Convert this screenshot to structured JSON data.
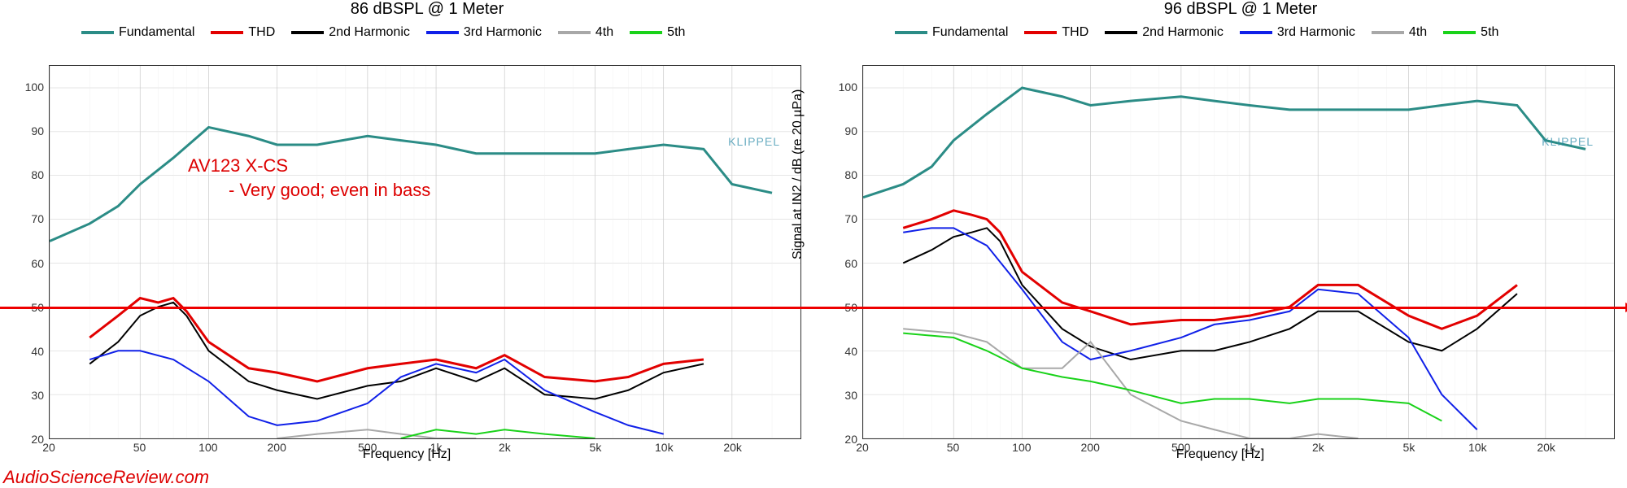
{
  "footer": "AudioScienceReview.com",
  "ref_line_db": 50,
  "legend": [
    {
      "name": "Fundamental",
      "color": "#2b8c86"
    },
    {
      "name": "THD",
      "color": "#e20000"
    },
    {
      "name": "2nd Harmonic",
      "color": "#000000"
    },
    {
      "name": "3rd Harmonic",
      "color": "#1020e8"
    },
    {
      "name": "4th",
      "color": "#a8a8a8"
    },
    {
      "name": "5th",
      "color": "#19d219"
    }
  ],
  "annotations": {
    "title": "AV123 X-CS",
    "subtitle": "- Very good; even in bass"
  },
  "klippel_logo": "KLIPPEL",
  "axes": {
    "xlabel": "Frequency [Hz]",
    "ylabel": "Signal at IN2 / dB (re 20 µPa)",
    "xlim": [
      20,
      40000
    ],
    "ylim": [
      20,
      105
    ],
    "xticks": [
      20,
      50,
      100,
      200,
      500,
      1000,
      2000,
      5000,
      10000,
      20000
    ],
    "xtick_labels": [
      "20",
      "50",
      "100",
      "200",
      "500",
      "1k",
      "2k",
      "5k",
      "10k",
      "20k"
    ],
    "yticks": [
      20,
      30,
      40,
      50,
      60,
      70,
      80,
      90,
      100
    ]
  },
  "chart_data": [
    {
      "title": "86 dBSPL @ 1 Meter",
      "type": "line",
      "xlabel": "Frequency [Hz]",
      "ylabel": "Signal at IN2 / dB (re 20 µPa)",
      "xscale": "log",
      "xlim": [
        20,
        40000
      ],
      "ylim": [
        20,
        105
      ],
      "series": [
        {
          "name": "Fundamental",
          "color": "#2b8c86",
          "x": [
            20,
            30,
            40,
            50,
            70,
            100,
            150,
            200,
            300,
            500,
            700,
            1000,
            1500,
            2000,
            3000,
            5000,
            7000,
            10000,
            15000,
            20000,
            30000
          ],
          "y": [
            65,
            69,
            73,
            78,
            84,
            91,
            89,
            87,
            87,
            89,
            88,
            87,
            85,
            85,
            85,
            85,
            86,
            87,
            86,
            78,
            76
          ]
        },
        {
          "name": "THD",
          "color": "#e20000",
          "x": [
            30,
            40,
            50,
            60,
            70,
            80,
            100,
            150,
            200,
            300,
            500,
            700,
            1000,
            1500,
            2000,
            3000,
            5000,
            7000,
            10000,
            15000
          ],
          "y": [
            43,
            48,
            52,
            51,
            52,
            49,
            42,
            36,
            35,
            33,
            36,
            37,
            38,
            36,
            39,
            34,
            33,
            34,
            37,
            38
          ]
        },
        {
          "name": "2nd Harmonic",
          "color": "#000000",
          "x": [
            30,
            40,
            50,
            60,
            70,
            80,
            100,
            150,
            200,
            300,
            500,
            700,
            1000,
            1500,
            2000,
            3000,
            5000,
            7000,
            10000,
            15000
          ],
          "y": [
            37,
            42,
            48,
            50,
            51,
            48,
            40,
            33,
            31,
            29,
            32,
            33,
            36,
            33,
            36,
            30,
            29,
            31,
            35,
            37
          ]
        },
        {
          "name": "3rd Harmonic",
          "color": "#1020e8",
          "x": [
            30,
            40,
            50,
            70,
            100,
            150,
            200,
            300,
            500,
            700,
            1000,
            1500,
            2000,
            3000,
            5000,
            7000,
            10000
          ],
          "y": [
            38,
            40,
            40,
            38,
            33,
            25,
            23,
            24,
            28,
            34,
            37,
            35,
            38,
            31,
            26,
            23,
            21
          ]
        },
        {
          "name": "4th",
          "color": "#a8a8a8",
          "x": [
            200,
            300,
            500,
            700,
            1000,
            1500
          ],
          "y": [
            20,
            21,
            22,
            21,
            20,
            20
          ]
        },
        {
          "name": "5th",
          "color": "#19d219",
          "x": [
            700,
            1000,
            1500,
            2000,
            3000,
            5000
          ],
          "y": [
            20,
            22,
            21,
            22,
            21,
            20
          ]
        }
      ]
    },
    {
      "title": "96 dBSPL @ 1 Meter",
      "type": "line",
      "xlabel": "Frequency [Hz]",
      "ylabel": "Signal at IN2 / dB (re 20 µPa)",
      "xscale": "log",
      "xlim": [
        20,
        40000
      ],
      "ylim": [
        20,
        105
      ],
      "series": [
        {
          "name": "Fundamental",
          "color": "#2b8c86",
          "x": [
            20,
            30,
            40,
            50,
            70,
            100,
            150,
            200,
            300,
            500,
            700,
            1000,
            1500,
            2000,
            3000,
            5000,
            7000,
            10000,
            15000,
            20000,
            30000
          ],
          "y": [
            75,
            78,
            82,
            88,
            94,
            100,
            98,
            96,
            97,
            98,
            97,
            96,
            95,
            95,
            95,
            95,
            96,
            97,
            96,
            88,
            86
          ]
        },
        {
          "name": "THD",
          "color": "#e20000",
          "x": [
            30,
            40,
            50,
            60,
            70,
            80,
            100,
            150,
            200,
            300,
            500,
            700,
            1000,
            1500,
            2000,
            3000,
            5000,
            7000,
            10000,
            15000
          ],
          "y": [
            68,
            70,
            72,
            71,
            70,
            67,
            58,
            51,
            49,
            46,
            47,
            47,
            48,
            50,
            55,
            55,
            48,
            45,
            48,
            55
          ]
        },
        {
          "name": "2nd Harmonic",
          "color": "#000000",
          "x": [
            30,
            40,
            50,
            60,
            70,
            80,
            100,
            150,
            200,
            300,
            500,
            700,
            1000,
            1500,
            2000,
            3000,
            5000,
            7000,
            10000,
            15000
          ],
          "y": [
            60,
            63,
            66,
            67,
            68,
            65,
            55,
            45,
            41,
            38,
            40,
            40,
            42,
            45,
            49,
            49,
            42,
            40,
            45,
            53
          ]
        },
        {
          "name": "3rd Harmonic",
          "color": "#1020e8",
          "x": [
            30,
            40,
            50,
            70,
            100,
            150,
            200,
            300,
            500,
            700,
            1000,
            1500,
            2000,
            3000,
            5000,
            7000,
            10000
          ],
          "y": [
            67,
            68,
            68,
            64,
            54,
            42,
            38,
            40,
            43,
            46,
            47,
            49,
            54,
            53,
            43,
            30,
            22
          ]
        },
        {
          "name": "4th",
          "color": "#a8a8a8",
          "x": [
            30,
            50,
            70,
            100,
            150,
            200,
            300,
            500,
            700,
            1000,
            1500,
            2000,
            3000
          ],
          "y": [
            45,
            44,
            42,
            36,
            36,
            42,
            30,
            24,
            22,
            20,
            20,
            21,
            20
          ]
        },
        {
          "name": "5th",
          "color": "#19d219",
          "x": [
            30,
            50,
            70,
            100,
            150,
            200,
            300,
            500,
            700,
            1000,
            1500,
            2000,
            3000,
            5000,
            7000
          ],
          "y": [
            44,
            43,
            40,
            36,
            34,
            33,
            31,
            28,
            29,
            29,
            28,
            29,
            29,
            28,
            24
          ]
        }
      ]
    }
  ]
}
